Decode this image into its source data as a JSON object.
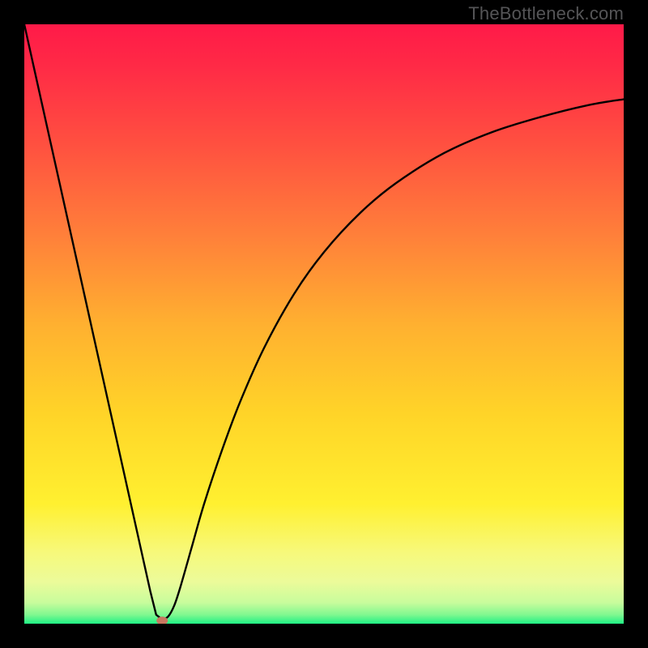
{
  "watermark": "TheBottleneck.com",
  "chart_data": {
    "type": "line",
    "title": "",
    "xlabel": "",
    "ylabel": "",
    "xlim": [
      0,
      100
    ],
    "ylim": [
      0,
      100
    ],
    "background_gradient": {
      "stops": [
        {
          "offset": 0.0,
          "color": "#ff1a48"
        },
        {
          "offset": 0.07,
          "color": "#ff2a46"
        },
        {
          "offset": 0.2,
          "color": "#ff5040"
        },
        {
          "offset": 0.35,
          "color": "#ff7f3a"
        },
        {
          "offset": 0.5,
          "color": "#ffb030"
        },
        {
          "offset": 0.65,
          "color": "#ffd428"
        },
        {
          "offset": 0.8,
          "color": "#fff030"
        },
        {
          "offset": 0.88,
          "color": "#f7f97a"
        },
        {
          "offset": 0.93,
          "color": "#ecfb9a"
        },
        {
          "offset": 0.965,
          "color": "#c8fc9c"
        },
        {
          "offset": 0.985,
          "color": "#80f890"
        },
        {
          "offset": 1.0,
          "color": "#1ff084"
        }
      ]
    },
    "series": [
      {
        "name": "bottleneck-curve",
        "color": "#000000",
        "width": 2.4,
        "x": [
          0,
          2,
          4,
          6,
          8,
          10,
          12,
          14,
          16,
          18,
          20,
          21,
          22,
          23,
          24,
          25,
          26,
          28,
          30,
          33,
          36,
          40,
          45,
          50,
          56,
          62,
          70,
          78,
          86,
          94,
          100
        ],
        "y": [
          100,
          91,
          82,
          73,
          64,
          55,
          46,
          37,
          28,
          19,
          10,
          5.5,
          1.5,
          0.7,
          1.2,
          3.0,
          6.0,
          13,
          20,
          29,
          37,
          46,
          55,
          62,
          68.5,
          73.5,
          78.5,
          82,
          84.5,
          86.5,
          87.5
        ]
      }
    ],
    "marker": {
      "name": "optimum-point",
      "x": 23,
      "y": 0.5,
      "color": "#c77860",
      "rx": 7,
      "ry": 5
    }
  }
}
